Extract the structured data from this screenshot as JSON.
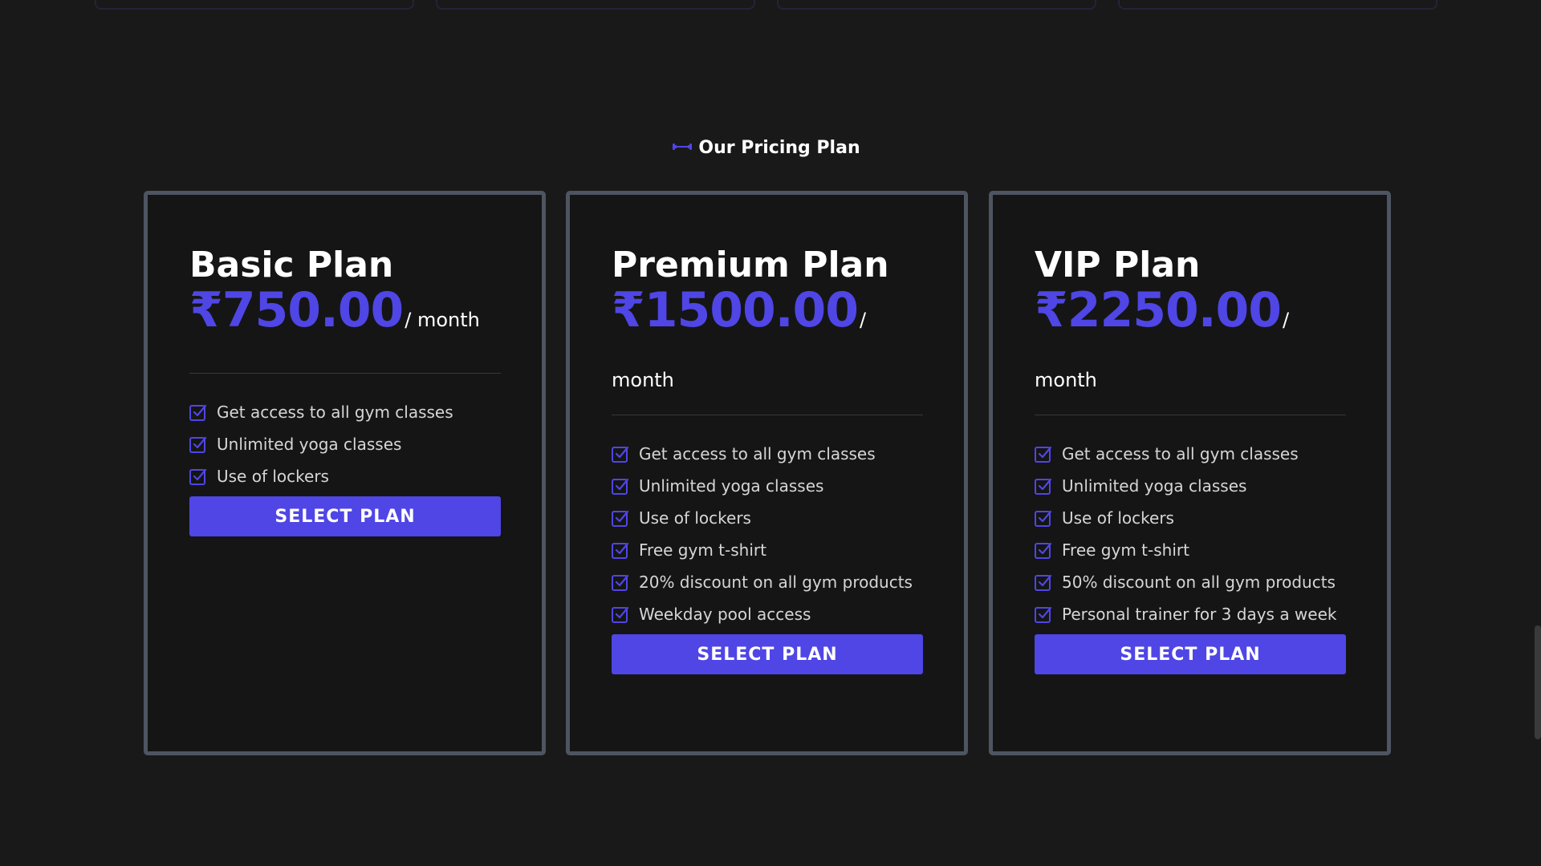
{
  "colors": {
    "background": "#191919",
    "accent": "#4f46e5",
    "card_border": "#4e5561"
  },
  "section": {
    "icon": "dumbbell-icon",
    "heading": "Our Pricing Plan"
  },
  "plans": [
    {
      "name": "Basic Plan",
      "price": "₹750.00",
      "period": "/ month",
      "features": [
        "Get access to all gym classes",
        "Unlimited yoga classes",
        "Use of lockers"
      ],
      "button": "SELECT PLAN"
    },
    {
      "name": "Premium Plan",
      "price": "₹1500.00",
      "period_sep": "/",
      "period": "month",
      "features": [
        "Get access to all gym classes",
        "Unlimited yoga classes",
        "Use of lockers",
        "Free gym t-shirt",
        "20% discount on all gym products",
        "Weekday pool access"
      ],
      "button": "SELECT PLAN"
    },
    {
      "name": "VIP Plan",
      "price": "₹2250.00",
      "period_sep": "/",
      "period": "month",
      "features": [
        "Get access to all gym classes",
        "Unlimited yoga classes",
        "Use of lockers",
        "Free gym t-shirt",
        "50% discount on all gym products",
        "Personal trainer for 3 days a week"
      ],
      "button": "SELECT PLAN"
    }
  ]
}
